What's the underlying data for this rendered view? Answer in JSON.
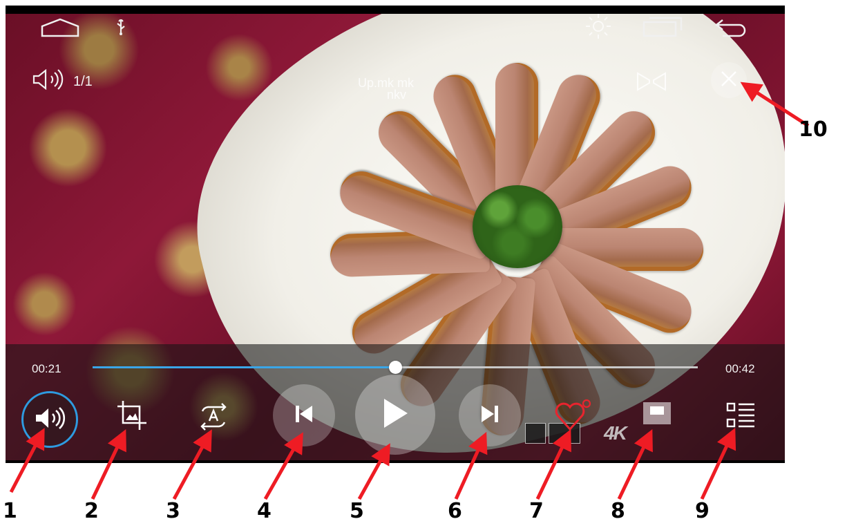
{
  "status_bar": {
    "icons": [
      "home-icon",
      "usb-icon",
      "brightness-icon",
      "recent-apps-icon",
      "back-icon"
    ]
  },
  "player": {
    "track_counter": "1/1",
    "filename_lines": [
      "Up.mk mk",
      "nkv"
    ],
    "time_elapsed": "00:21",
    "time_total": "00:42",
    "progress": 0.5,
    "accent_color": "#3aa6e8"
  },
  "controls": {
    "volume": "volume-icon",
    "crop": "crop-icon",
    "repeat": "repeat-ab-icon",
    "previous": "skip-previous-icon",
    "play": "play-icon",
    "next": "skip-next-icon",
    "favorite": "heart-icon",
    "screen": "screen-mode-icon",
    "playlist": "playlist-icon",
    "close": "close-icon"
  },
  "watermark": {
    "text": "4K"
  },
  "callouts": [
    "1",
    "2",
    "3",
    "4",
    "5",
    "6",
    "7",
    "8",
    "9",
    "10"
  ]
}
